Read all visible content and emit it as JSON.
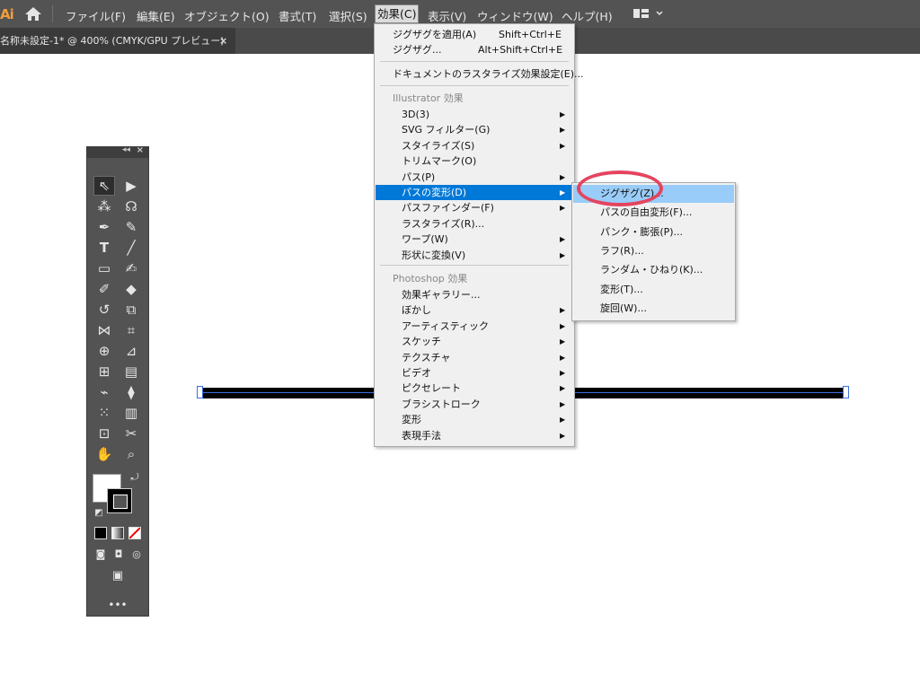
{
  "app": {
    "logo": "Ai"
  },
  "menubar": {
    "items": [
      "ファイル(F)",
      "編集(E)",
      "オブジェクト(O)",
      "書式(T)",
      "選択(S)",
      "効果(C)",
      "表示(V)",
      "ウィンドウ(W)",
      "ヘルプ(H)"
    ],
    "active": "効果(C)"
  },
  "document_tab": {
    "title": "名称未設定-1* @ 400% (CMYK/GPU プレビュー)",
    "close": "×"
  },
  "effect_menu": {
    "top": [
      {
        "label": "ジグザグを適用(A)",
        "shortcut": "Shift+Ctrl+E"
      },
      {
        "label": "ジグザグ...",
        "shortcut": "Alt+Shift+Ctrl+E"
      }
    ],
    "doc_raster": "ドキュメントのラスタライズ効果設定(E)...",
    "illustrator_header": "Illustrator 効果",
    "illustrator_items": [
      {
        "label": "3D(3)",
        "submenu": true
      },
      {
        "label": "SVG フィルター(G)",
        "submenu": true
      },
      {
        "label": "スタイライズ(S)",
        "submenu": true
      },
      {
        "label": "トリムマーク(O)",
        "submenu": false
      },
      {
        "label": "パス(P)",
        "submenu": true
      },
      {
        "label": "パスの変形(D)",
        "submenu": true,
        "highlighted": true
      },
      {
        "label": "パスファインダー(F)",
        "submenu": true
      },
      {
        "label": "ラスタライズ(R)...",
        "submenu": false
      },
      {
        "label": "ワープ(W)",
        "submenu": true
      },
      {
        "label": "形状に変換(V)",
        "submenu": true
      }
    ],
    "photoshop_header": "Photoshop 効果",
    "photoshop_items": [
      {
        "label": "効果ギャラリー...",
        "submenu": false
      },
      {
        "label": "ぼかし",
        "submenu": true
      },
      {
        "label": "アーティスティック",
        "submenu": true
      },
      {
        "label": "スケッチ",
        "submenu": true
      },
      {
        "label": "テクスチャ",
        "submenu": true
      },
      {
        "label": "ビデオ",
        "submenu": true
      },
      {
        "label": "ピクセレート",
        "submenu": true
      },
      {
        "label": "ブラシストローク",
        "submenu": true
      },
      {
        "label": "変形",
        "submenu": true
      },
      {
        "label": "表現手法",
        "submenu": true
      }
    ]
  },
  "submenu": {
    "items": [
      "ジグザグ(Z)...",
      "パスの自由変形(F)...",
      "パンク・膨張(P)...",
      "ラフ(R)...",
      "ランダム・ひねり(K)...",
      "変形(T)...",
      "旋回(W)..."
    ],
    "highlighted": "ジグザグ(Z)..."
  },
  "colors": {
    "menubar": "#535353",
    "highlight": "#0078d7",
    "sub_highlight": "#99ccf8",
    "annotation": "#e5445f"
  }
}
